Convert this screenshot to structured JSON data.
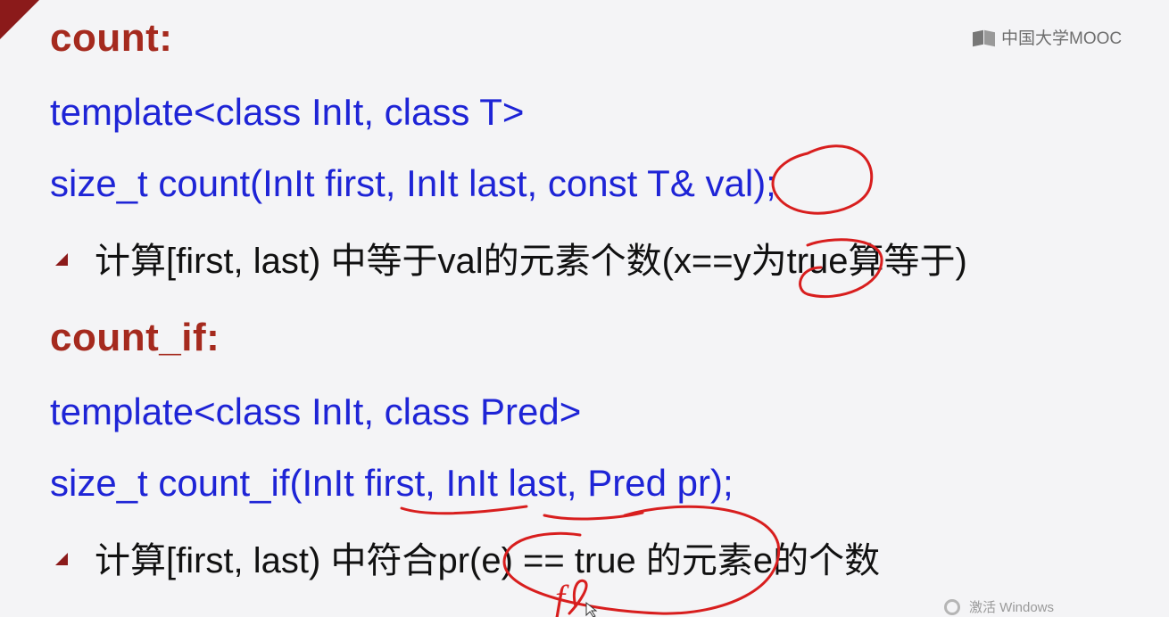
{
  "logo": {
    "text": "中国大学MOOC",
    "icon": "mooc-logo-icon"
  },
  "sections": [
    {
      "heading": "count:",
      "code_line_1": "template<class InIt, class T>",
      "code_line_2": "size_t count(InIt first, InIt last, const T& val);",
      "bullet": "计算[first, last) 中等于val的元素个数(x==y为true算等于)"
    },
    {
      "heading": "count_if:",
      "code_line_1": "template<class InIt, class Pred>",
      "code_line_2": "size_t count_if(InIt first, InIt last, Pred pr);",
      "bullet": "计算[first, last) 中符合pr(e) == true 的元素e的个数"
    }
  ],
  "annotations": {
    "handwritten_letter": "f"
  },
  "watermark": {
    "text": "激活 Windows",
    "icon": "windows-activation-icon"
  },
  "colors": {
    "heading": "#a52a1e",
    "code": "#1e24d6",
    "text": "#111111",
    "ink": "#d81e1e",
    "accent": "#8b1a1a"
  }
}
